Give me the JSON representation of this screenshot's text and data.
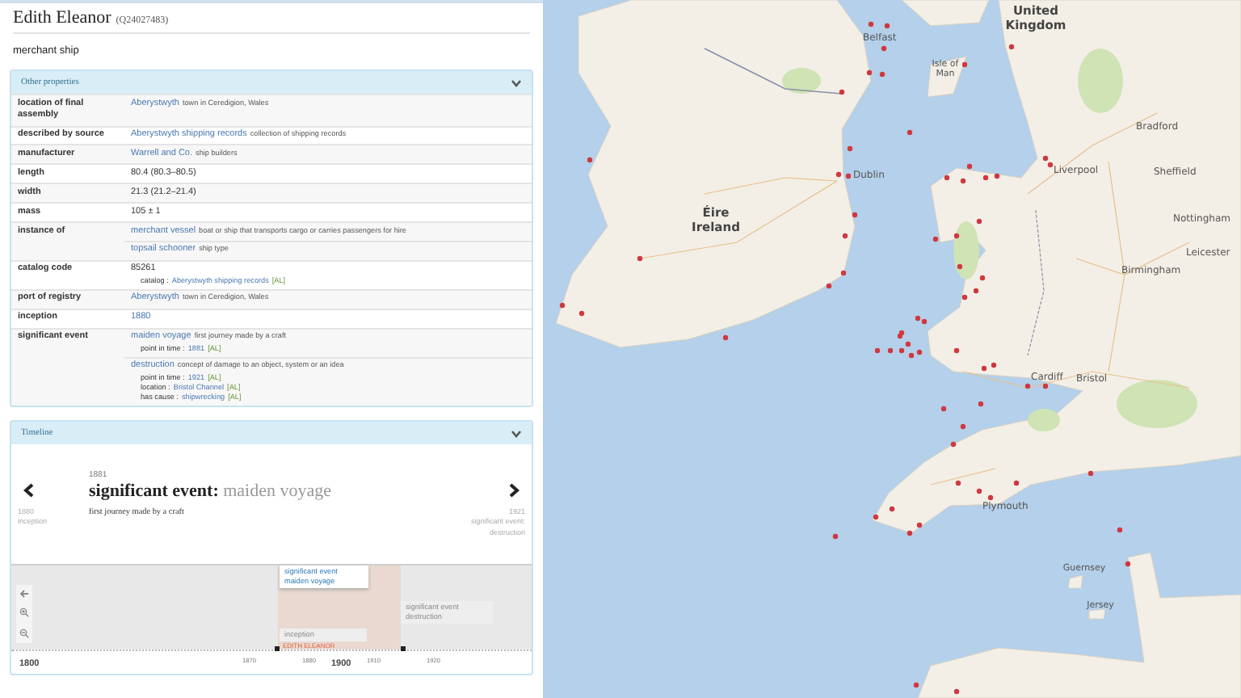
{
  "item": {
    "title": "Edith Eleanor",
    "id": "(Q24027483)",
    "description": "merchant ship"
  },
  "properties_panel": {
    "title": "Other properties",
    "expanded": true
  },
  "properties": [
    {
      "label": "location of final assembly",
      "values": [
        {
          "kind": "link",
          "text": "Aberystwyth",
          "description": "town in Ceredigion, Wales"
        }
      ]
    },
    {
      "label": "described by source",
      "values": [
        {
          "kind": "link",
          "text": "Aberystwyth shipping records",
          "description": "collection of shipping records"
        }
      ]
    },
    {
      "label": "manufacturer",
      "values": [
        {
          "kind": "link",
          "text": "Warrell and Co.",
          "description": "ship builders"
        }
      ]
    },
    {
      "label": "length",
      "values": [
        {
          "kind": "plain",
          "text": "80.4 (80.3–80.5)"
        }
      ]
    },
    {
      "label": "width",
      "values": [
        {
          "kind": "plain",
          "text": "21.3 (21.2–21.4)"
        }
      ]
    },
    {
      "label": "mass",
      "values": [
        {
          "kind": "plain",
          "text": "105 ± 1"
        }
      ]
    },
    {
      "label": "instance of",
      "values": [
        {
          "kind": "link",
          "text": "merchant vessel",
          "description": "boat or ship that transports cargo or carries passengers for hire"
        },
        {
          "kind": "link",
          "text": "topsail schooner",
          "description": "ship type"
        }
      ]
    },
    {
      "label": "catalog code",
      "values": [
        {
          "kind": "plain",
          "text": "85261",
          "qualifiers": [
            {
              "name": "catalog :",
              "value": "Aberystwyth shipping records",
              "reference": "[AL]"
            }
          ]
        }
      ]
    },
    {
      "label": "port of registry",
      "values": [
        {
          "kind": "link",
          "text": "Aberystwyth",
          "description": "town in Ceredigion, Wales"
        }
      ]
    },
    {
      "label": "inception",
      "values": [
        {
          "kind": "link",
          "text": "1880"
        }
      ]
    },
    {
      "label": "significant event",
      "values": [
        {
          "kind": "link",
          "text": "maiden voyage",
          "description": "first journey made by a craft",
          "qualifiers": [
            {
              "name": "point in time :",
              "value": "1881",
              "reference": "[AL]"
            }
          ]
        },
        {
          "kind": "link",
          "text": "destruction",
          "description": "concept of damage to an object, system or an idea",
          "qualifiers": [
            {
              "name": "point in time :",
              "value": "1921",
              "reference": "[AL]"
            },
            {
              "name": "location :",
              "value": "Bristol Channel",
              "reference": "[AL]"
            },
            {
              "name": "has cause :",
              "value": "shipwrecking",
              "reference": "[AL]"
            }
          ]
        }
      ]
    }
  ],
  "timeline_panel": {
    "title": "Timeline",
    "expanded": true
  },
  "event_card": {
    "previous": {
      "year": "1880",
      "label": "inception"
    },
    "current": {
      "year": "1881",
      "property": "significant event:",
      "value": "maiden voyage",
      "description": "first journey made by a craft"
    },
    "next": {
      "year": "1921",
      "label": "significant event: destruction"
    }
  },
  "timeline": {
    "items": [
      {
        "label": "significant event maiden voyage",
        "selected": true
      },
      {
        "label": "inception",
        "selected": false
      },
      {
        "label": "significant event destruction",
        "selected": false
      }
    ],
    "axis_labels": [
      {
        "text": "1800",
        "kind": "major"
      },
      {
        "text": "1870",
        "kind": "minor"
      },
      {
        "text": "1880",
        "kind": "minor"
      },
      {
        "text": "1900",
        "kind": "major"
      },
      {
        "text": "1910",
        "kind": "minor"
      },
      {
        "text": "1920",
        "kind": "minor"
      }
    ],
    "marker_label": "EDITH ELEANOR"
  },
  "map": {
    "labels": [
      {
        "text": "United Kingdom",
        "kind": "country"
      },
      {
        "text": "Belfast",
        "kind": "city"
      },
      {
        "text": "Isle of Man",
        "kind": "island"
      },
      {
        "text": "Bradford",
        "kind": "city"
      },
      {
        "text": "Liverpool",
        "kind": "city"
      },
      {
        "text": "Sheffield",
        "kind": "city"
      },
      {
        "text": "Dublin",
        "kind": "city"
      },
      {
        "text": "Éire Ireland",
        "kind": "country"
      },
      {
        "text": "Nottingham",
        "kind": "city"
      },
      {
        "text": "Leicester",
        "kind": "city"
      },
      {
        "text": "Birmingham",
        "kind": "city"
      },
      {
        "text": "Cardiff",
        "kind": "city"
      },
      {
        "text": "Bristol",
        "kind": "city"
      },
      {
        "text": "Plymouth",
        "kind": "city"
      },
      {
        "text": "Guernsey",
        "kind": "island"
      },
      {
        "text": "Jersey",
        "kind": "island"
      }
    ]
  }
}
